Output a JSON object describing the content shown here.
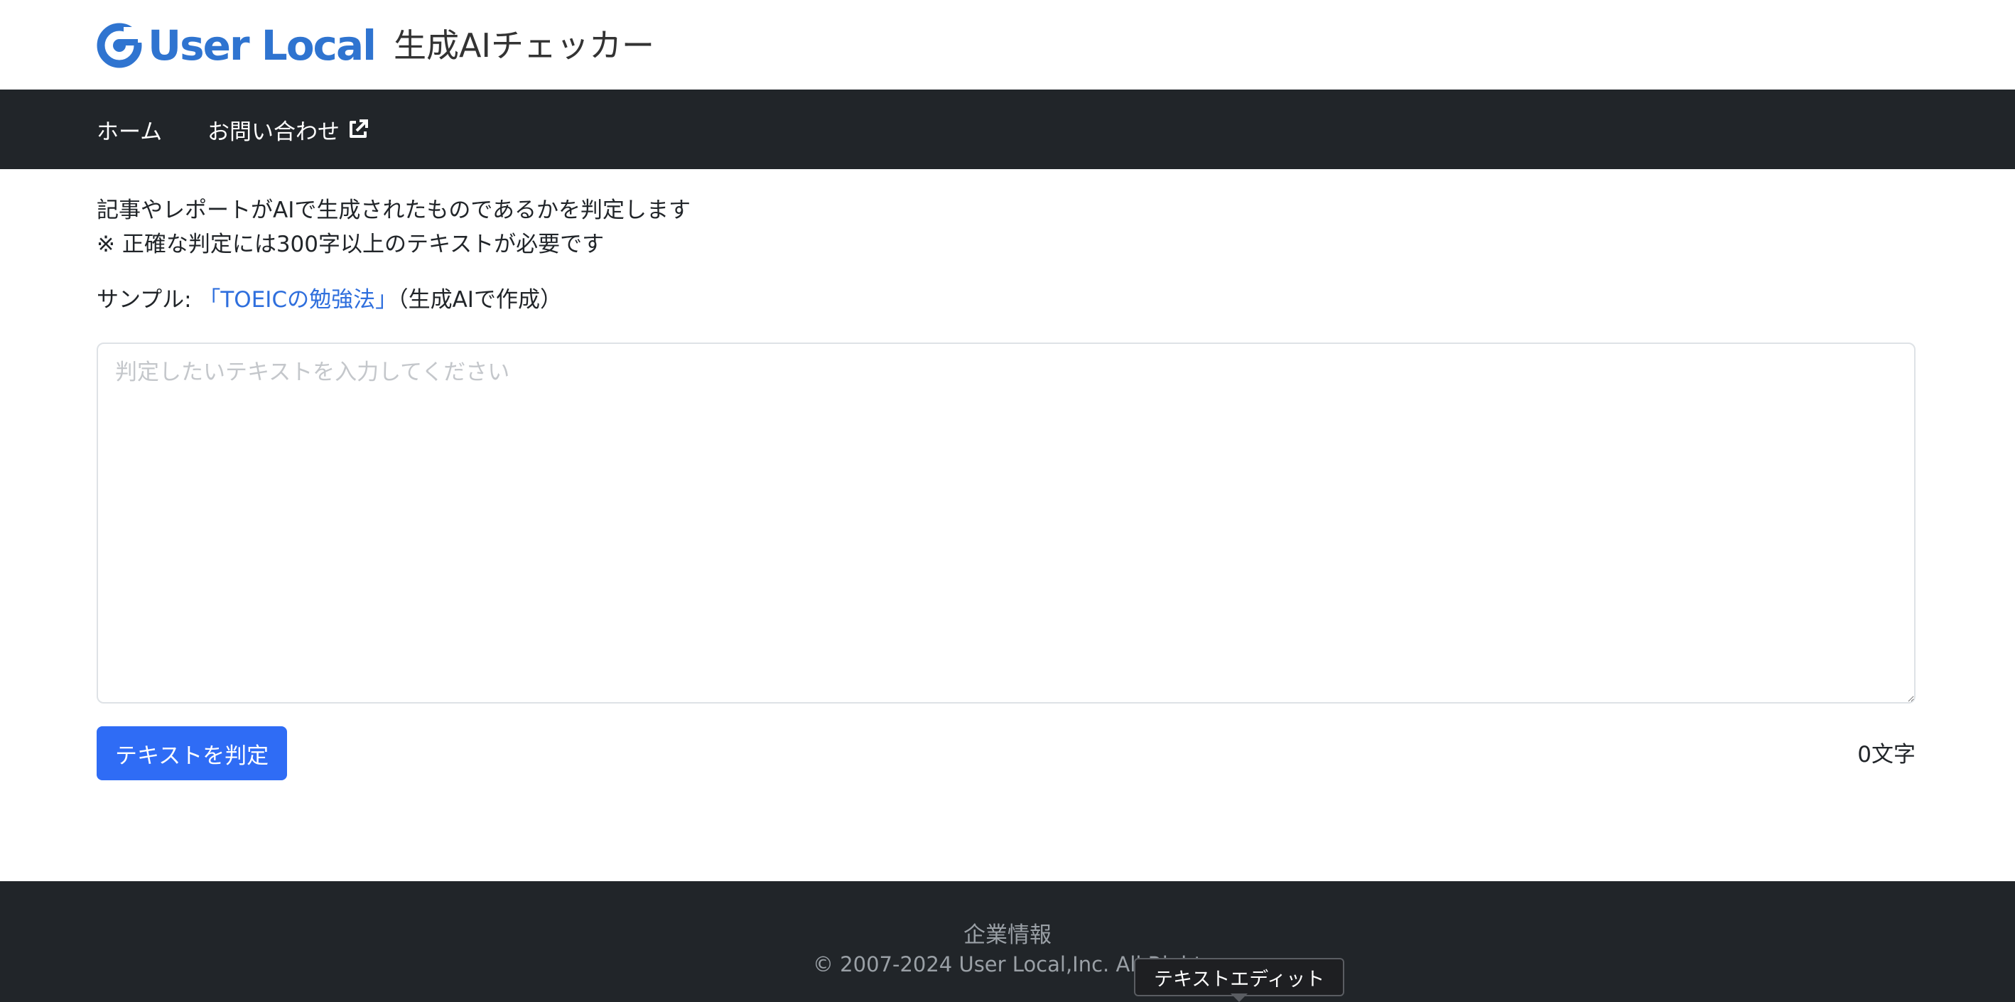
{
  "header": {
    "logo_text": "User Local",
    "app_title": "生成AIチェッカー"
  },
  "nav": {
    "home": "ホーム",
    "contact": "お問い合わせ"
  },
  "intro": {
    "line1": "記事やレポートがAIで生成されたものであるかを判定します",
    "line2": "※ 正確な判定には300字以上のテキストが必要です"
  },
  "sample": {
    "prefix": "サンプル: ",
    "link": "「TOEICの勉強法」",
    "suffix": "（生成AIで作成）"
  },
  "input": {
    "placeholder": "判定したいテキストを入力してください",
    "value": ""
  },
  "actions": {
    "judge_button": "テキストを判定",
    "char_count": "0文字"
  },
  "footer": {
    "company_link": "企業情報",
    "copyright": "© 2007-2024 User Local,Inc. All Right"
  },
  "tooltip": {
    "text": "テキストエディット"
  },
  "colors": {
    "brand": "#2f74d0",
    "navbar": "#212529",
    "primary_button": "#2f6cf5",
    "link": "#2f6fdd"
  }
}
